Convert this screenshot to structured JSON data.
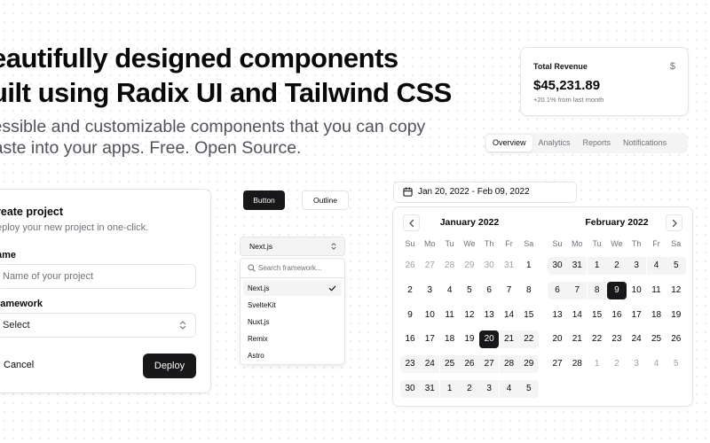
{
  "hero": {
    "title_line1": "eautifully designed components",
    "title_line2": "uilt using Radix UI and Tailwind CSS",
    "subtitle_line1": "ccessible and customizable components that you can copy",
    "subtitle_line2": "l paste into your apps. Free. Open Source."
  },
  "revenue": {
    "label": "Total Revenue",
    "icon": "dollar-icon",
    "currency_symbol": "$",
    "value": "$45,231.89",
    "change": "+20.1% from last month"
  },
  "tabs": [
    {
      "label": "Overview",
      "active": true
    },
    {
      "label": "Analytics",
      "active": false
    },
    {
      "label": "Reports",
      "active": false
    },
    {
      "label": "Notifications",
      "active": false
    }
  ],
  "project": {
    "title": "reate project",
    "description": "eploy your new project in one-click.",
    "name_label": "ame",
    "name_placeholder": "Name of your project",
    "framework_label": "ramework",
    "framework_value": "Select",
    "cancel_label": "Cancel",
    "deploy_label": "Deploy"
  },
  "buttons": {
    "primary_label": "Button",
    "outline_label": "Outline"
  },
  "combobox": {
    "selected": "Next.js",
    "search_placeholder": "Search framework...",
    "options": [
      "Next.js",
      "SvelteKit",
      "Nuxt.js",
      "Remix",
      "Astro"
    ]
  },
  "date_range": {
    "label": "Jan 20, 2022 - Feb 09, 2022"
  },
  "calendar": {
    "weekdays": [
      "Su",
      "Mo",
      "Tu",
      "We",
      "Th",
      "Fr",
      "Sa"
    ],
    "months": [
      {
        "title": "January 2022",
        "days": [
          {
            "d": "26",
            "out": true
          },
          {
            "d": "27",
            "out": true
          },
          {
            "d": "28",
            "out": true
          },
          {
            "d": "29",
            "out": true
          },
          {
            "d": "30",
            "out": true
          },
          {
            "d": "31",
            "out": true
          },
          {
            "d": "1"
          },
          {
            "d": "2"
          },
          {
            "d": "3"
          },
          {
            "d": "4"
          },
          {
            "d": "5"
          },
          {
            "d": "6"
          },
          {
            "d": "7"
          },
          {
            "d": "8"
          },
          {
            "d": "9"
          },
          {
            "d": "10"
          },
          {
            "d": "11"
          },
          {
            "d": "12"
          },
          {
            "d": "13"
          },
          {
            "d": "14"
          },
          {
            "d": "15"
          },
          {
            "d": "16"
          },
          {
            "d": "17"
          },
          {
            "d": "18"
          },
          {
            "d": "19"
          },
          {
            "d": "20",
            "sel": true
          },
          {
            "d": "21",
            "rng": true
          },
          {
            "d": "22",
            "rng": true
          },
          {
            "d": "23",
            "rng": true
          },
          {
            "d": "24",
            "rng": true
          },
          {
            "d": "25",
            "rng": true
          },
          {
            "d": "26",
            "rng": true
          },
          {
            "d": "27",
            "rng": true
          },
          {
            "d": "28",
            "rng": true
          },
          {
            "d": "29",
            "rng": true
          },
          {
            "d": "30",
            "rng": true
          },
          {
            "d": "31",
            "rng": true
          },
          {
            "d": "1",
            "rng": true
          },
          {
            "d": "2",
            "rng": true
          },
          {
            "d": "3",
            "rng": true
          },
          {
            "d": "4",
            "rng": true
          },
          {
            "d": "5",
            "rng": true
          }
        ]
      },
      {
        "title": "February 2022",
        "days": [
          {
            "d": "30",
            "rng": true
          },
          {
            "d": "31",
            "rng": true
          },
          {
            "d": "1",
            "rng": true
          },
          {
            "d": "2",
            "rng": true
          },
          {
            "d": "3",
            "rng": true
          },
          {
            "d": "4",
            "rng": true
          },
          {
            "d": "5",
            "rng": true
          },
          {
            "d": "6",
            "rng": true
          },
          {
            "d": "7",
            "rng": true
          },
          {
            "d": "8",
            "rng": true
          },
          {
            "d": "9",
            "sel": true
          },
          {
            "d": "10"
          },
          {
            "d": "11"
          },
          {
            "d": "12"
          },
          {
            "d": "13"
          },
          {
            "d": "14"
          },
          {
            "d": "15"
          },
          {
            "d": "16"
          },
          {
            "d": "17"
          },
          {
            "d": "18"
          },
          {
            "d": "19"
          },
          {
            "d": "20"
          },
          {
            "d": "21"
          },
          {
            "d": "22"
          },
          {
            "d": "23"
          },
          {
            "d": "24"
          },
          {
            "d": "25"
          },
          {
            "d": "26"
          },
          {
            "d": "27"
          },
          {
            "d": "28"
          },
          {
            "d": "1",
            "out": true
          },
          {
            "d": "2",
            "out": true
          },
          {
            "d": "3",
            "out": true
          },
          {
            "d": "4",
            "out": true
          },
          {
            "d": "5",
            "out": true
          }
        ]
      }
    ]
  }
}
